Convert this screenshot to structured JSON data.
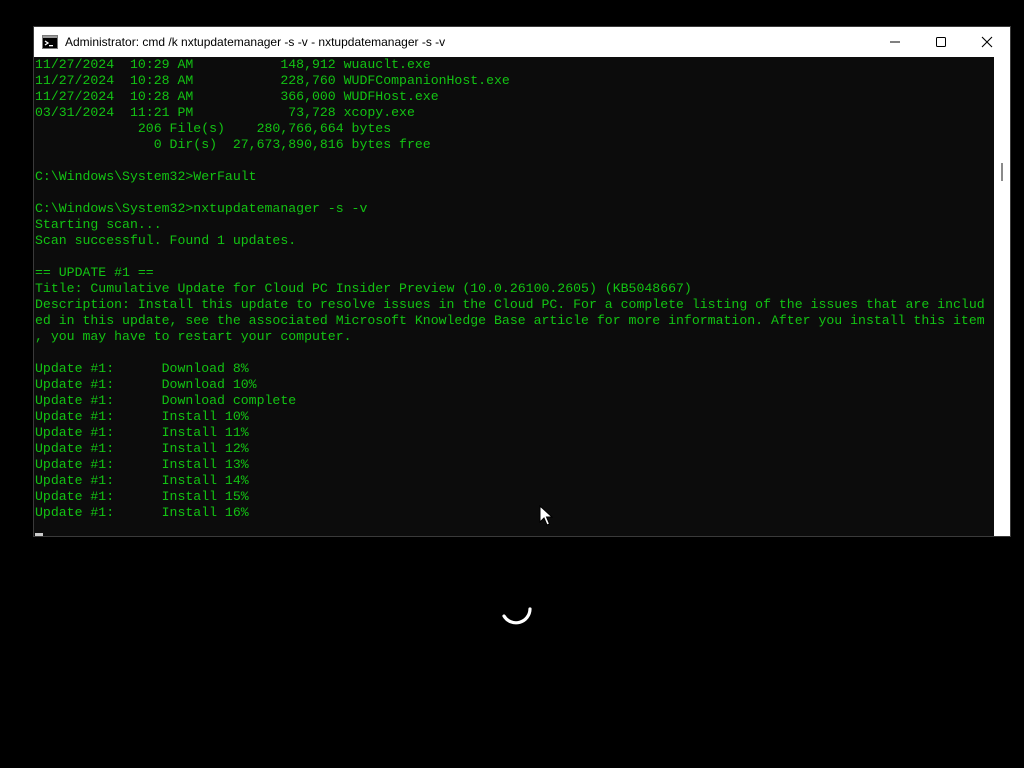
{
  "window": {
    "title": "Administrator: cmd /k nxtupdatemanager -s -v - nxtupdatemanager  -s -v",
    "icon": "cmd-icon",
    "controls": [
      "minimize-icon",
      "maximize-icon",
      "close-icon"
    ]
  },
  "console": {
    "text_color": "#13c313",
    "lines": [
      "11/27/2024  10:29 AM           148,912 wuauclt.exe",
      "11/27/2024  10:28 AM           228,760 WUDFCompanionHost.exe",
      "11/27/2024  10:28 AM           366,000 WUDFHost.exe",
      "03/31/2024  11:21 PM            73,728 xcopy.exe",
      "             206 File(s)    280,766,664 bytes",
      "               0 Dir(s)  27,673,890,816 bytes free",
      "",
      "C:\\Windows\\System32>WerFault",
      "",
      "C:\\Windows\\System32>nxtupdatemanager -s -v",
      "Starting scan...",
      "Scan successful. Found 1 updates.",
      "",
      "== UPDATE #1 ==",
      "Title: Cumulative Update for Cloud PC Insider Preview (10.0.26100.2605) (KB5048667)",
      "Description: Install this update to resolve issues in the Cloud PC. For a complete listing of the issues that are includ",
      "ed in this update, see the associated Microsoft Knowledge Base article for more information. After you install this item",
      ", you may have to restart your computer.",
      "",
      "Update #1:      Download 8%",
      "Update #1:      Download 10%",
      "Update #1:      Download complete",
      "Update #1:      Install 10%",
      "Update #1:      Install 11%",
      "Update #1:      Install 12%",
      "Update #1:      Install 13%",
      "Update #1:      Install 14%",
      "Update #1:      Install 15%",
      "Update #1:      Install 16%"
    ]
  },
  "overlay": {
    "pointer": "mouse-pointer-icon",
    "spinner": "loading-spinner-icon"
  }
}
